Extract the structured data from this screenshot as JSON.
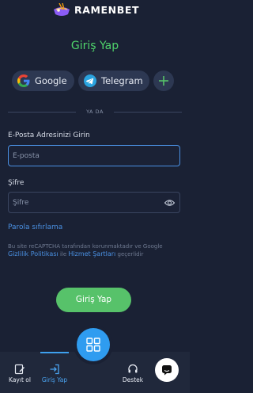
{
  "brand": {
    "name": "RAMENBET"
  },
  "page_title": "Giriş Yap",
  "social": [
    {
      "label": "Google",
      "icon": "google-icon"
    },
    {
      "label": "Telegram",
      "icon": "telegram-icon"
    },
    {
      "label": "",
      "icon": "plus-icon"
    }
  ],
  "divider_text": "YA DA",
  "email": {
    "label": "E-Posta Adresinizi Girin",
    "placeholder": "E-posta",
    "value": ""
  },
  "password": {
    "label": "Şifre",
    "placeholder": "Şifre",
    "value": "",
    "toggle_icon": "eye-icon"
  },
  "forgot_link": "Parola sıfırlama",
  "legal": {
    "part1": "Bu site reCAPTCHA tarafından korunmaktadır ve Google",
    "privacy_link": "Gizlilik Politikası",
    "part2": "ile",
    "terms_link": "Hizmet Şartları",
    "part3": "geçerlidir"
  },
  "submit_label": "Giriş Yap",
  "bottom_nav": [
    {
      "label": "Kayıt ol",
      "icon": "register-icon",
      "active": false
    },
    {
      "label": "Giriş Yap",
      "icon": "login-icon",
      "active": true
    },
    {
      "label": "",
      "icon": "grid-menu-icon",
      "active": false
    },
    {
      "label": "Destek",
      "icon": "headset-icon",
      "active": false
    },
    {
      "label": "",
      "icon": "chat-icon",
      "active": false
    }
  ],
  "colors": {
    "background": "#1a2134",
    "title_green": "#4fd46b",
    "button_green": "#57c26a",
    "link_blue": "#4a90e2",
    "accent_blue": "#2f9cf0"
  }
}
